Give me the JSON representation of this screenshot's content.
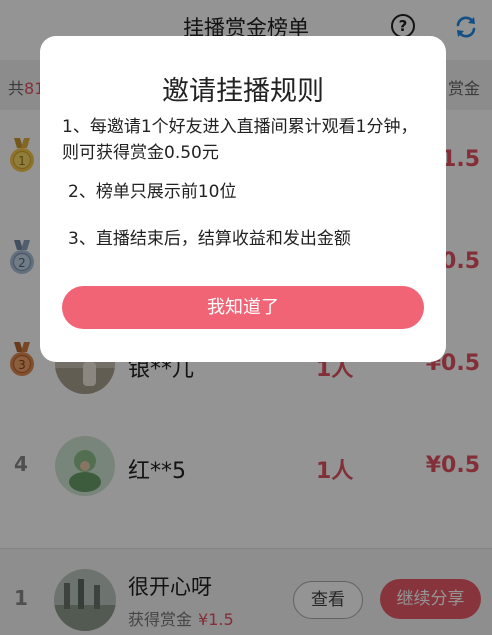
{
  "header": {
    "title": "挂播赏金榜单",
    "help_icon": "question-circle-icon",
    "help_glyph": "?",
    "refresh_icon": "refresh-icon",
    "accent": "#1e88e5"
  },
  "summary": {
    "prefix": "共",
    "count": "81",
    "right_label": "赏金"
  },
  "rows": [
    {
      "rank": "1",
      "medal": "gold-medal-icon",
      "name": "",
      "count": "",
      "money": "¥1.5"
    },
    {
      "rank": "2",
      "medal": "silver-medal-icon",
      "name": "",
      "count": "",
      "money": "¥0.5"
    },
    {
      "rank": "3",
      "medal": "bronze-medal-icon",
      "name": "银**儿",
      "count": "1人",
      "money": "¥0.5"
    },
    {
      "rank": "4",
      "medal": "",
      "name": "红**5",
      "count": "1人",
      "money": "¥0.5"
    }
  ],
  "footer": {
    "rank": "1",
    "name": "很开心呀",
    "sub_label": "获得赏金",
    "sub_amount": "¥1.5",
    "view_label": "查看",
    "share_label": "继续分享"
  },
  "modal": {
    "title": "邀请挂播规则",
    "rules": [
      "1、每邀请1个好友进入直播间累计观看1分钟，则可获得赏金0.50元",
      "2、榜单只展示前10位",
      "3、直播结束后，结算收益和发出金额"
    ],
    "ok_label": "我知道了"
  },
  "colors": {
    "accent_red": "#e2525f",
    "button_pink": "#f06475",
    "share_button": "#e85a68"
  }
}
